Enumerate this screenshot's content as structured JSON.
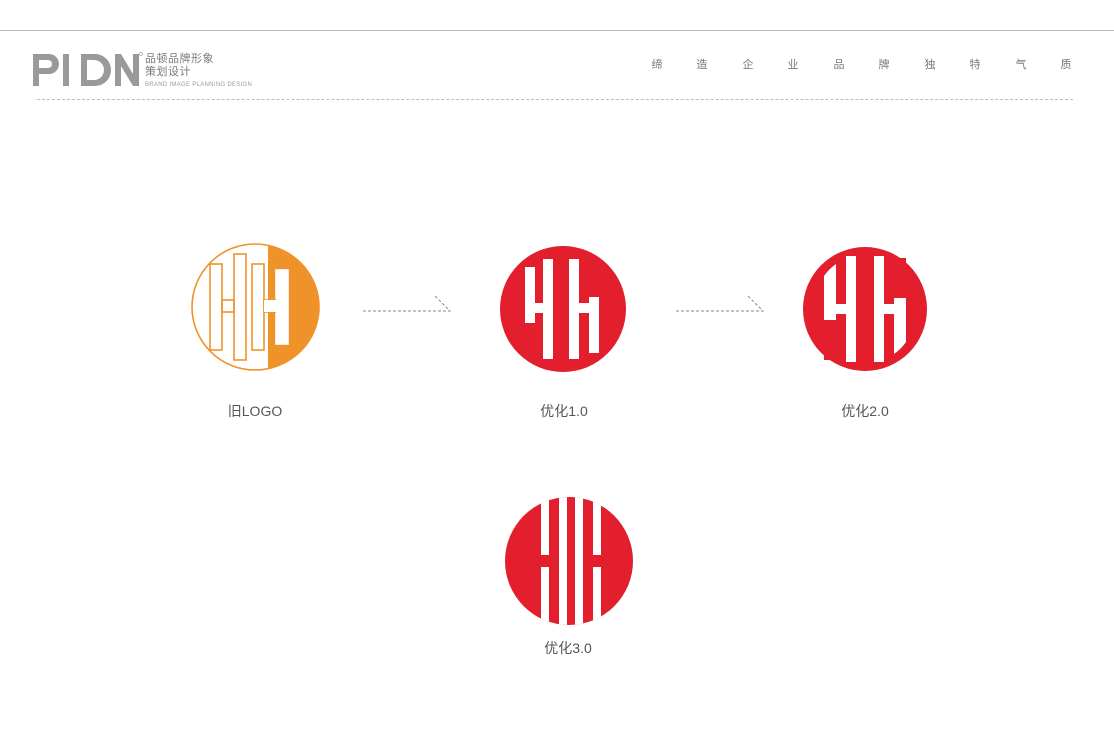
{
  "header": {
    "brand_logo_text": "PIDN",
    "brand_line1": "品顿品牌形象",
    "brand_line2": "策划设计",
    "brand_line3": "BRAND IMAGE PLANNING DESIGN",
    "slogan_chars": [
      "缔",
      "造",
      "企",
      "业",
      "品",
      "牌",
      "独",
      "特",
      "气",
      "质"
    ]
  },
  "logos": [
    {
      "caption": "旧LOGO",
      "color": "#F0922A"
    },
    {
      "caption": "优化1.0",
      "color": "#E31E2D"
    },
    {
      "caption": "优化2.0",
      "color": "#E31E2D"
    },
    {
      "caption": "优化3.0",
      "color": "#E31E2D"
    }
  ],
  "colors": {
    "orange": "#F0922A",
    "red": "#E31E2D",
    "gray_text": "#555555"
  }
}
